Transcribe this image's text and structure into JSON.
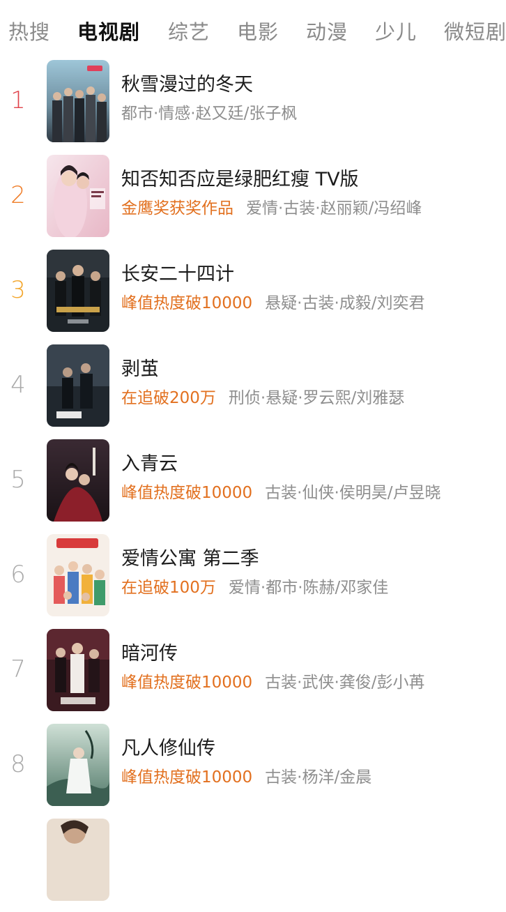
{
  "tabs": [
    {
      "label": "热搜",
      "active": false
    },
    {
      "label": "电视剧",
      "active": true
    },
    {
      "label": "综艺",
      "active": false
    },
    {
      "label": "电影",
      "active": false
    },
    {
      "label": "动漫",
      "active": false
    },
    {
      "label": "少儿",
      "active": false
    },
    {
      "label": "微短剧",
      "active": false
    }
  ],
  "rank_colors": {
    "1": "#e0424a",
    "2": "#ef7e2a",
    "3": "#f3a52a",
    "default": "#a9a9a9"
  },
  "badge_color": "#e2701f",
  "items": [
    {
      "rank": "1",
      "title": "秋雪漫过的冬天",
      "badge": "",
      "tags": "都市·情感·赵又廷/张子枫"
    },
    {
      "rank": "2",
      "title": "知否知否应是绿肥红瘦 TV版",
      "badge": "金鹰奖获奖作品",
      "tags": "爱情·古装·赵丽颖/冯绍峰"
    },
    {
      "rank": "3",
      "title": "长安二十四计",
      "badge": "峰值热度破10000",
      "tags": "悬疑·古装·成毅/刘奕君"
    },
    {
      "rank": "4",
      "title": "剥茧",
      "badge": "在追破200万",
      "tags": "刑侦·悬疑·罗云熙/刘雅瑟"
    },
    {
      "rank": "5",
      "title": "入青云",
      "badge": "峰值热度破10000",
      "tags": "古装·仙侠·侯明昊/卢昱晓"
    },
    {
      "rank": "6",
      "title": "爱情公寓 第二季",
      "badge": "在追破100万",
      "tags": "爱情·都市·陈赫/邓家佳"
    },
    {
      "rank": "7",
      "title": "暗河传",
      "badge": "峰值热度破10000",
      "tags": "古装·武侠·龚俊/彭小苒"
    },
    {
      "rank": "8",
      "title": "凡人修仙传",
      "badge": "峰值热度破10000",
      "tags": "古装·杨洋/金晨"
    },
    {
      "rank": "",
      "title": "",
      "badge": "",
      "tags": ""
    }
  ]
}
